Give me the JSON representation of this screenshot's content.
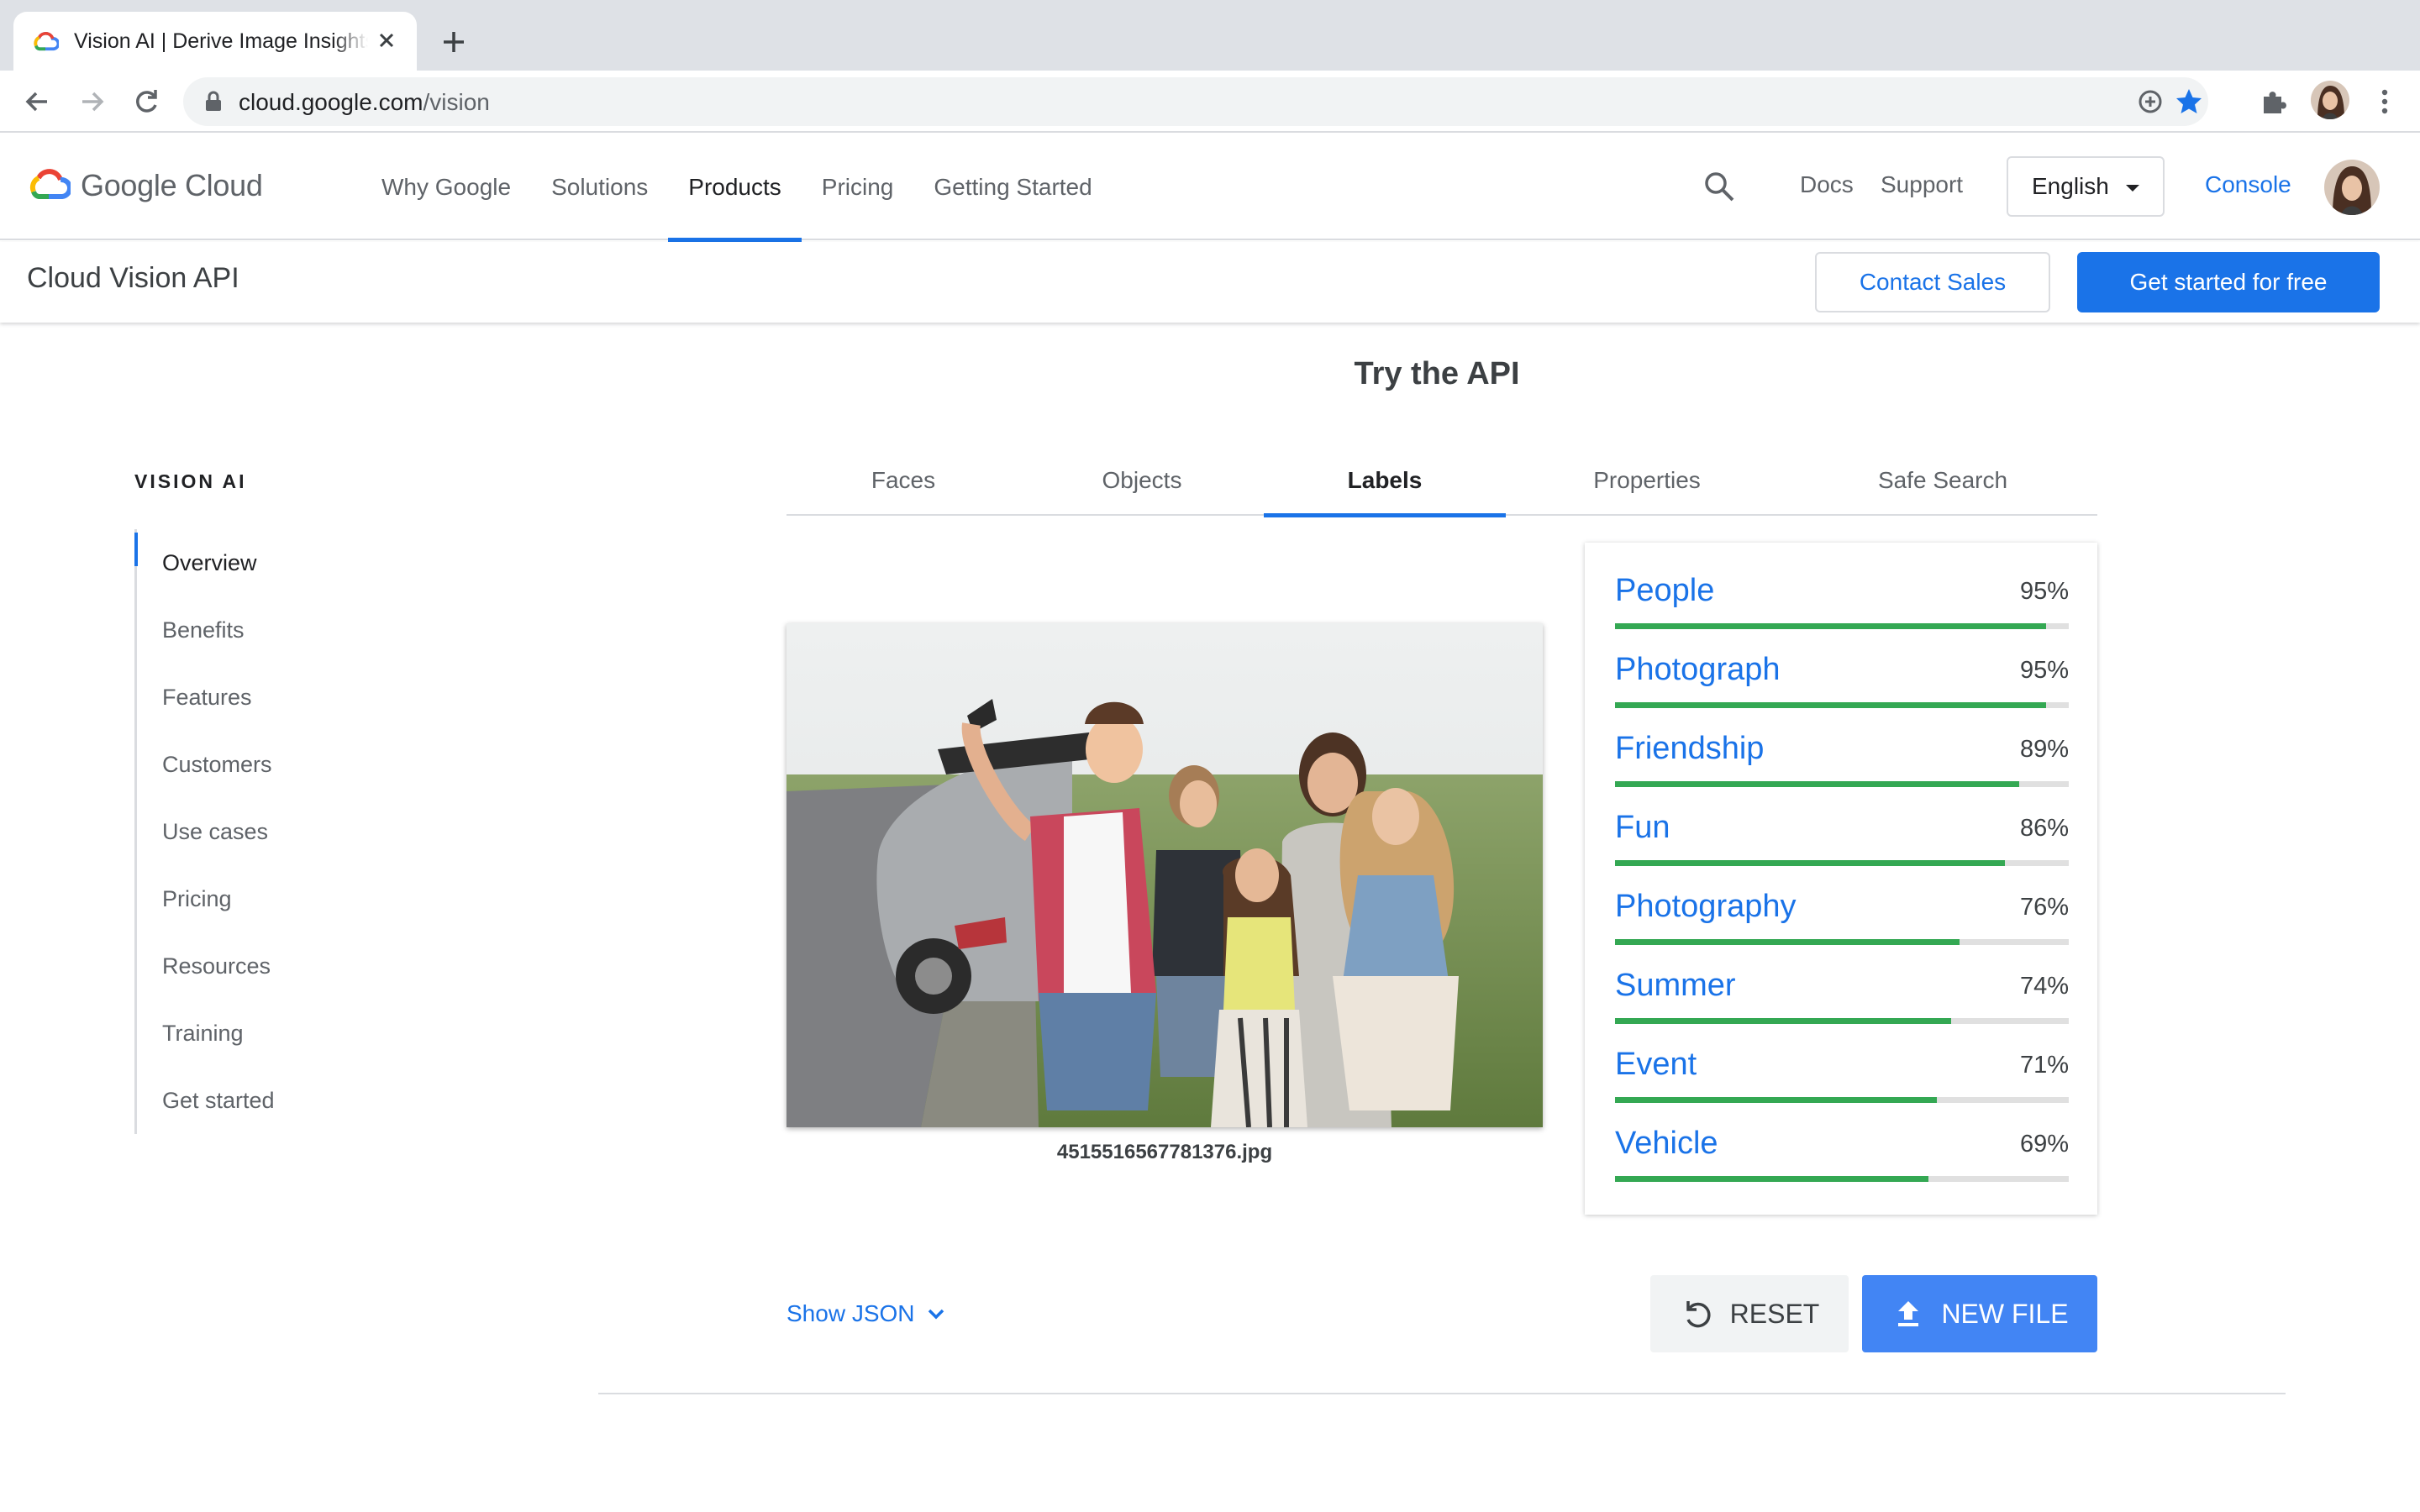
{
  "browser": {
    "tab_title": "Vision AI | Derive Image Insights via ML",
    "url_host": "cloud.google.com",
    "url_path": "/vision"
  },
  "header": {
    "brand": "Google Cloud",
    "nav": [
      {
        "label": "Why Google"
      },
      {
        "label": "Solutions"
      },
      {
        "label": "Products",
        "active": true
      },
      {
        "label": "Pricing"
      },
      {
        "label": "Getting Started"
      }
    ],
    "docs": "Docs",
    "support": "Support",
    "language": "English",
    "console": "Console"
  },
  "subheader": {
    "title": "Cloud Vision API",
    "contact_sales": "Contact Sales",
    "get_started": "Get started for free"
  },
  "sidenav": {
    "heading": "VISION AI",
    "items": [
      {
        "label": "Overview",
        "active": true
      },
      {
        "label": "Benefits"
      },
      {
        "label": "Features"
      },
      {
        "label": "Customers"
      },
      {
        "label": "Use cases"
      },
      {
        "label": "Pricing"
      },
      {
        "label": "Resources"
      },
      {
        "label": "Training"
      },
      {
        "label": "Get started"
      }
    ]
  },
  "demo": {
    "title": "Try the API",
    "tabs": [
      {
        "label": "Faces"
      },
      {
        "label": "Objects"
      },
      {
        "label": "Labels",
        "active": true
      },
      {
        "label": "Properties"
      },
      {
        "label": "Safe Search"
      }
    ],
    "filename": "4515516567781376.jpg",
    "labels": [
      {
        "name": "People",
        "percent": "95%",
        "score": 0.95
      },
      {
        "name": "Photograph",
        "percent": "95%",
        "score": 0.95
      },
      {
        "name": "Friendship",
        "percent": "89%",
        "score": 0.89
      },
      {
        "name": "Fun",
        "percent": "86%",
        "score": 0.86
      },
      {
        "name": "Photography",
        "percent": "76%",
        "score": 0.76
      },
      {
        "name": "Summer",
        "percent": "74%",
        "score": 0.74
      },
      {
        "name": "Event",
        "percent": "71%",
        "score": 0.71
      },
      {
        "name": "Vehicle",
        "percent": "69%",
        "score": 0.69
      }
    ],
    "show_json": "Show JSON",
    "reset": "RESET",
    "new_file": "NEW FILE"
  },
  "colors": {
    "accent": "#1a73e8",
    "score_bar": "#34a853",
    "new_file_button": "#4285f4"
  }
}
